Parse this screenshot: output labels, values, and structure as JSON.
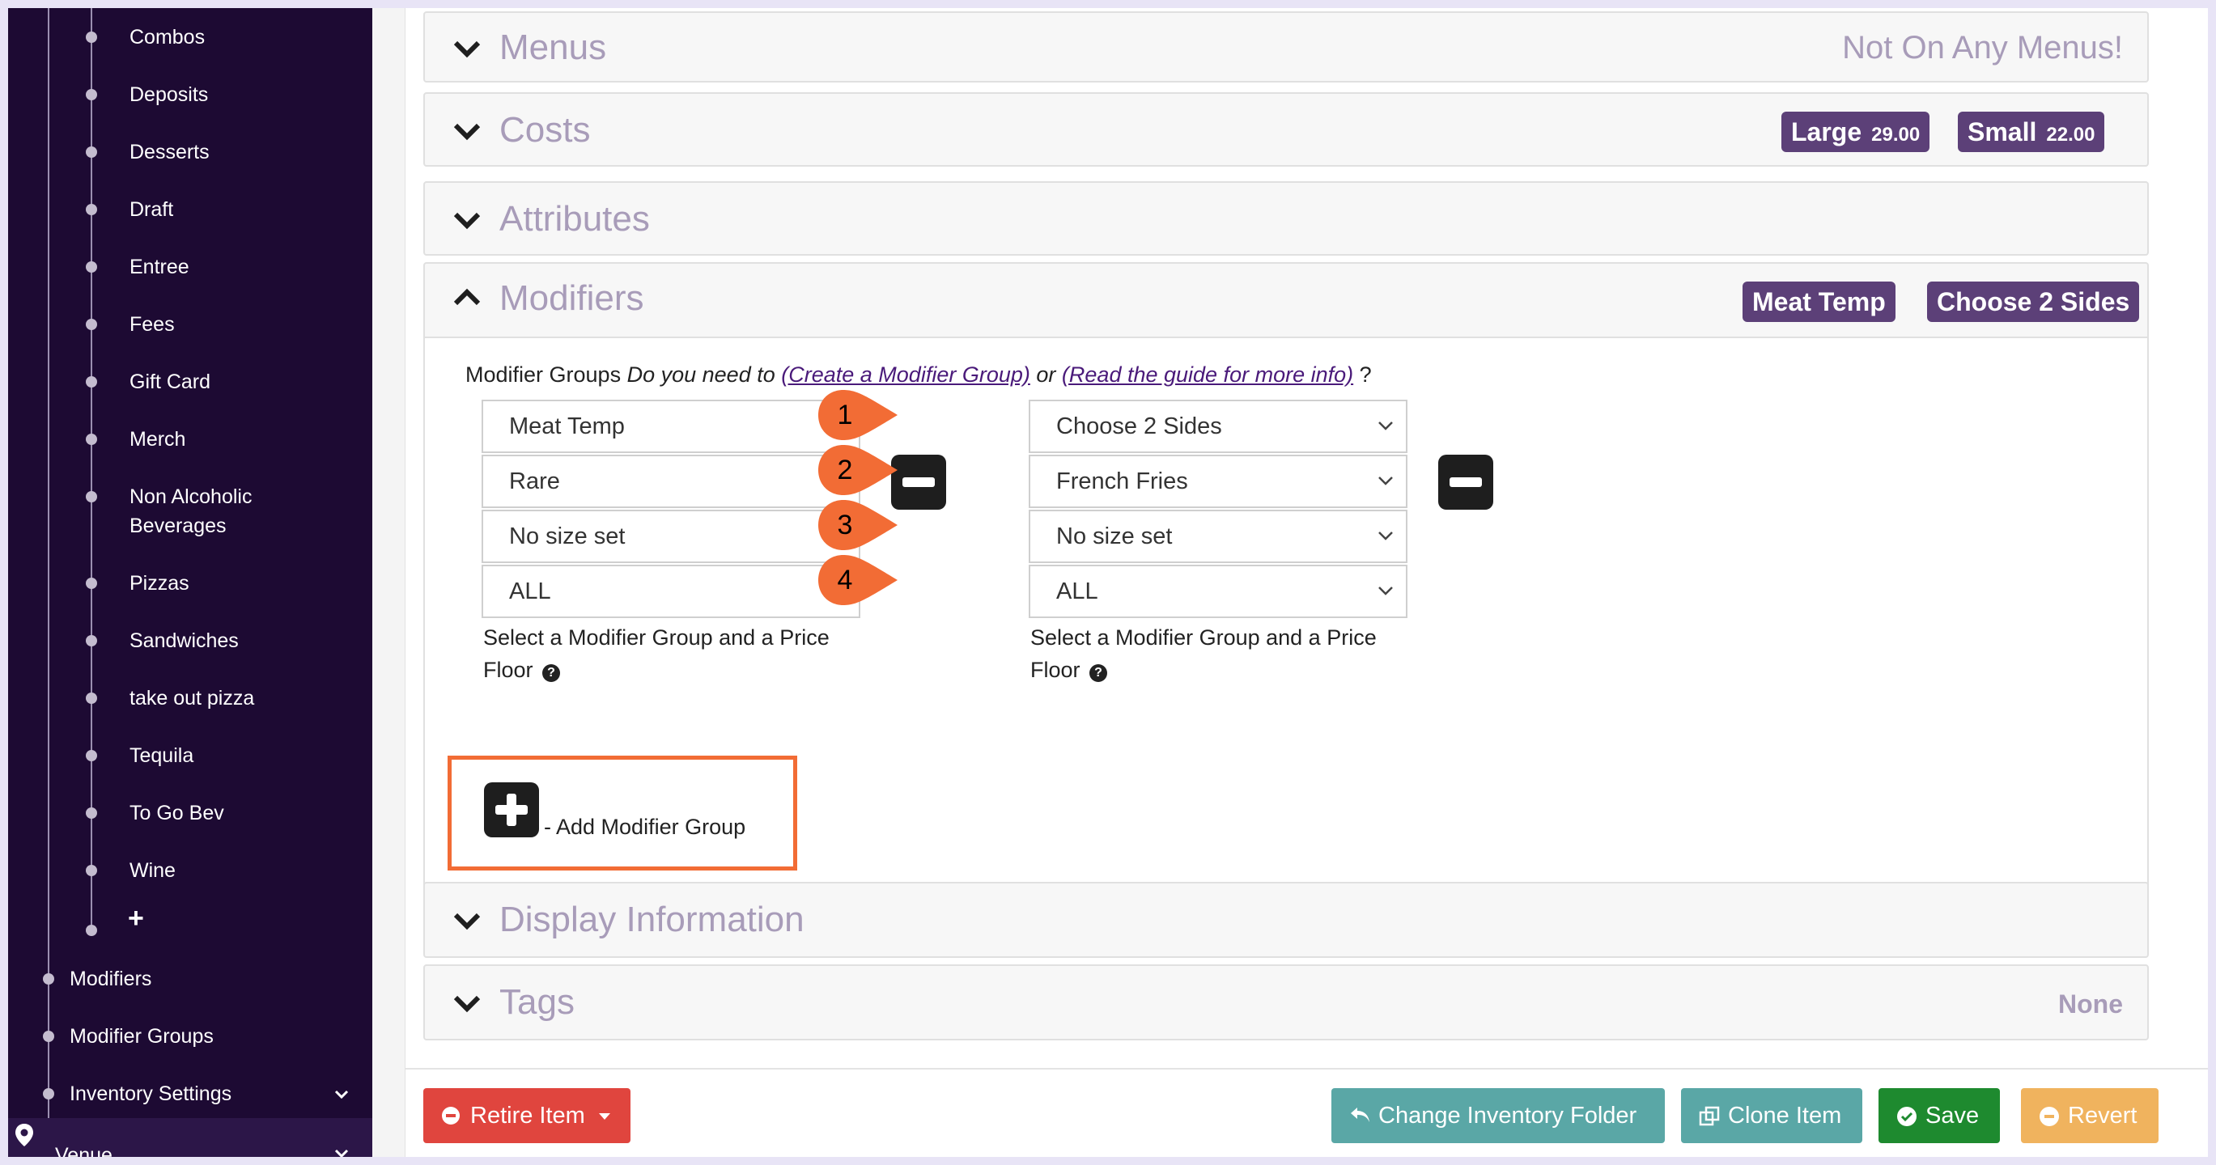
{
  "sidebar": {
    "categories": [
      {
        "label": "Combos"
      },
      {
        "label": "Deposits"
      },
      {
        "label": "Desserts"
      },
      {
        "label": "Draft"
      },
      {
        "label": "Entree"
      },
      {
        "label": "Fees"
      },
      {
        "label": "Gift Card"
      },
      {
        "label": "Merch"
      },
      {
        "label": "Non Alcoholic",
        "label2": "Beverages"
      },
      {
        "label": "Pizzas"
      },
      {
        "label": "Sandwiches"
      },
      {
        "label": "take out pizza"
      },
      {
        "label": "Tequila"
      },
      {
        "label": "To Go Bev"
      },
      {
        "label": "Wine"
      }
    ],
    "add_symbol": "+",
    "sections": [
      {
        "label": "Modifiers"
      },
      {
        "label": "Modifier Groups"
      },
      {
        "label": "Inventory Settings"
      }
    ],
    "venue_label": "Venue"
  },
  "panels": {
    "menus": {
      "title": "Menus",
      "status": "Not On Any Menus!"
    },
    "costs": {
      "title": "Costs",
      "badges": [
        {
          "label": "Large",
          "value": "29.00"
        },
        {
          "label": "Small",
          "value": "22.00"
        }
      ]
    },
    "attributes": {
      "title": "Attributes"
    },
    "modifiers": {
      "title": "Modifiers",
      "badges": [
        "Meat Temp",
        "Choose 2 Sides"
      ],
      "intro": {
        "prefix": "Modifier Groups",
        "question": "Do you need to",
        "link1": "(Create a Modifier Group)",
        "or": "or",
        "link2": "(Read the guide for more info)",
        "suffix": "?"
      },
      "groups": [
        {
          "group": "Meat Temp",
          "default": "Rare",
          "size": "No size set",
          "floor": "ALL",
          "help1": "Select a Modifier Group and a Price",
          "help2": "Floor"
        },
        {
          "group": "Choose 2 Sides",
          "default": "French Fries",
          "size": "No size set",
          "floor": "ALL",
          "help1": "Select a Modifier Group and a Price",
          "help2": "Floor"
        }
      ],
      "markers": [
        "1",
        "2",
        "3",
        "4"
      ],
      "help_icon": "?",
      "add_label": "- Add Modifier Group"
    },
    "display": {
      "title": "Display Information"
    },
    "tags": {
      "title": "Tags",
      "status": "None"
    }
  },
  "footer": {
    "retire": "Retire Item",
    "change_folder": "Change Inventory Folder",
    "clone": "Clone Item",
    "save": "Save",
    "revert": "Revert"
  },
  "colors": {
    "sidebar_bg": "#1d0a33",
    "badge_bg": "#5c4078",
    "title_color": "#a89cb9",
    "marker_orange": "#f26c35",
    "retire_red": "#e0453e",
    "teal": "#5aa7a6",
    "save_green": "#1e8a2f",
    "revert_orange": "#f0b35e"
  },
  "icons": [
    "map-pin-icon",
    "chevron-down-icon",
    "chevron-up-icon",
    "minus-icon",
    "plus-icon",
    "question-circle-icon",
    "undo-arrow-icon",
    "clone-icon",
    "check-circle-icon",
    "minus-circle-icon",
    "caret-down-icon"
  ]
}
